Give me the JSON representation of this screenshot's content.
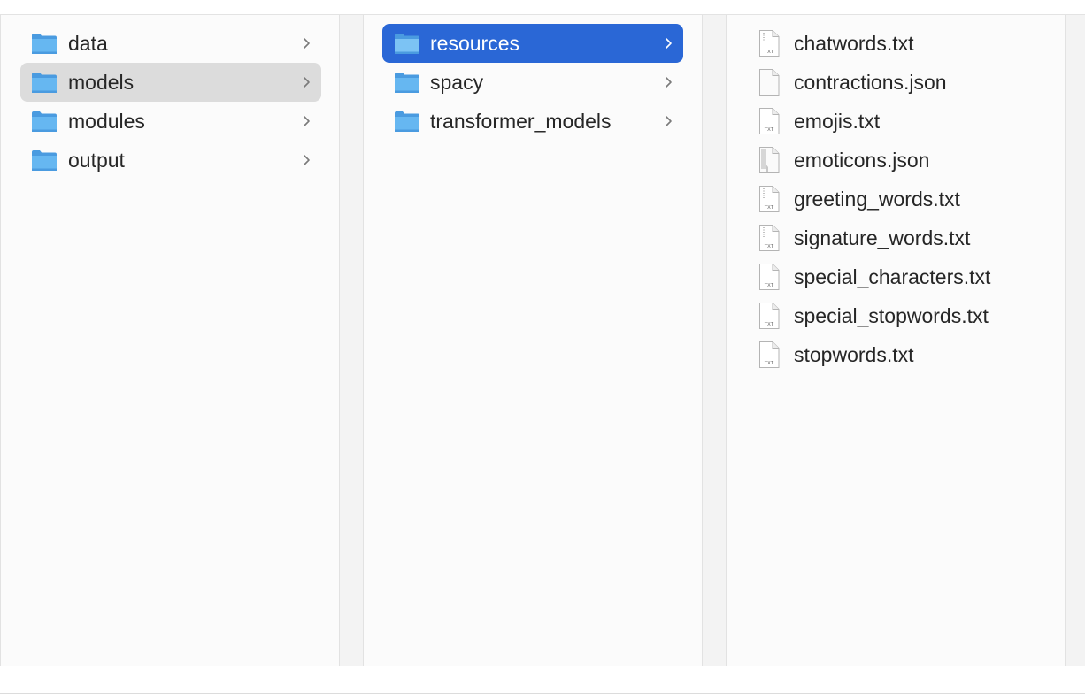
{
  "columns": [
    {
      "items": [
        {
          "label": "data",
          "icon": "folder-icon",
          "state": "normal",
          "has_children": true
        },
        {
          "label": "models",
          "icon": "folder-icon",
          "state": "selected-inactive",
          "has_children": true
        },
        {
          "label": "modules",
          "icon": "folder-icon",
          "state": "normal",
          "has_children": true
        },
        {
          "label": "output",
          "icon": "folder-icon",
          "state": "normal",
          "has_children": true
        }
      ]
    },
    {
      "items": [
        {
          "label": "resources",
          "icon": "folder-icon",
          "state": "selected-active",
          "has_children": true
        },
        {
          "label": "spacy",
          "icon": "folder-icon",
          "state": "normal",
          "has_children": true
        },
        {
          "label": "transformer_models",
          "icon": "folder-icon",
          "state": "normal",
          "has_children": true
        }
      ]
    },
    {
      "items": [
        {
          "label": "chatwords.txt",
          "icon": "txt-file-icon",
          "state": "normal"
        },
        {
          "label": "contractions.json",
          "icon": "blank-file-icon",
          "state": "normal"
        },
        {
          "label": "emojis.txt",
          "icon": "txt-file-icon",
          "state": "normal"
        },
        {
          "label": "emoticons.json",
          "icon": "json-file-icon",
          "state": "normal"
        },
        {
          "label": "greeting_words.txt",
          "icon": "txt-file-icon",
          "state": "normal"
        },
        {
          "label": "signature_words.txt",
          "icon": "txt-file-icon",
          "state": "normal"
        },
        {
          "label": "special_characters.txt",
          "icon": "txt-file-icon",
          "state": "normal"
        },
        {
          "label": "special_stopwords.txt",
          "icon": "txt-file-icon",
          "state": "normal"
        },
        {
          "label": "stopwords.txt",
          "icon": "txt-file-icon",
          "state": "normal"
        }
      ]
    }
  ],
  "colors": {
    "selected_active": "#2a67d6",
    "selected_inactive": "#dcdcdc",
    "folder": "#5fb0ee",
    "text": "#262626"
  },
  "file_badge": "TXT"
}
